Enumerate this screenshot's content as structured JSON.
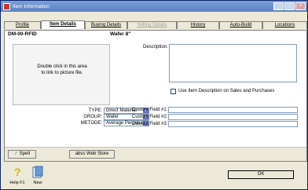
{
  "window": {
    "title": "Item Information"
  },
  "tabs": [
    {
      "label": "Profile"
    },
    {
      "label": "Item Details"
    },
    {
      "label": "Buying Details"
    },
    {
      "label": "Selling Details"
    },
    {
      "label": "History"
    },
    {
      "label": "Auto-Build"
    },
    {
      "label": "Locations"
    }
  ],
  "item": {
    "id": "DM-00-RFID",
    "name": "Wafer 8\""
  },
  "picture": {
    "hint_line1": "Double click in this area",
    "hint_line2": "to link to picture file."
  },
  "description": {
    "label": "Description:",
    "value": "",
    "use_desc_label": "Use Item Description on Sales and Purchases",
    "use_desc_checked": false
  },
  "fields": {
    "type_label": "TYPE:",
    "type_value": "Direct Material",
    "group_label": "GROUP:",
    "group_value": "Wafer",
    "metode_label": "METODE:",
    "metode_value": "Average Perpetual",
    "custom1_label": "Custom Field #1:",
    "custom2_label": "Custom Field #2:",
    "custom3_label": "Custom Field #3:",
    "custom1_value": "",
    "custom2_value": "",
    "custom3_value": ""
  },
  "bottom": {
    "spell_label": "Spell",
    "webstore_label": "abss Web Store"
  },
  "toolbar": {
    "help_label": "Help F1",
    "new_label": "New",
    "ok_label": "OK"
  }
}
